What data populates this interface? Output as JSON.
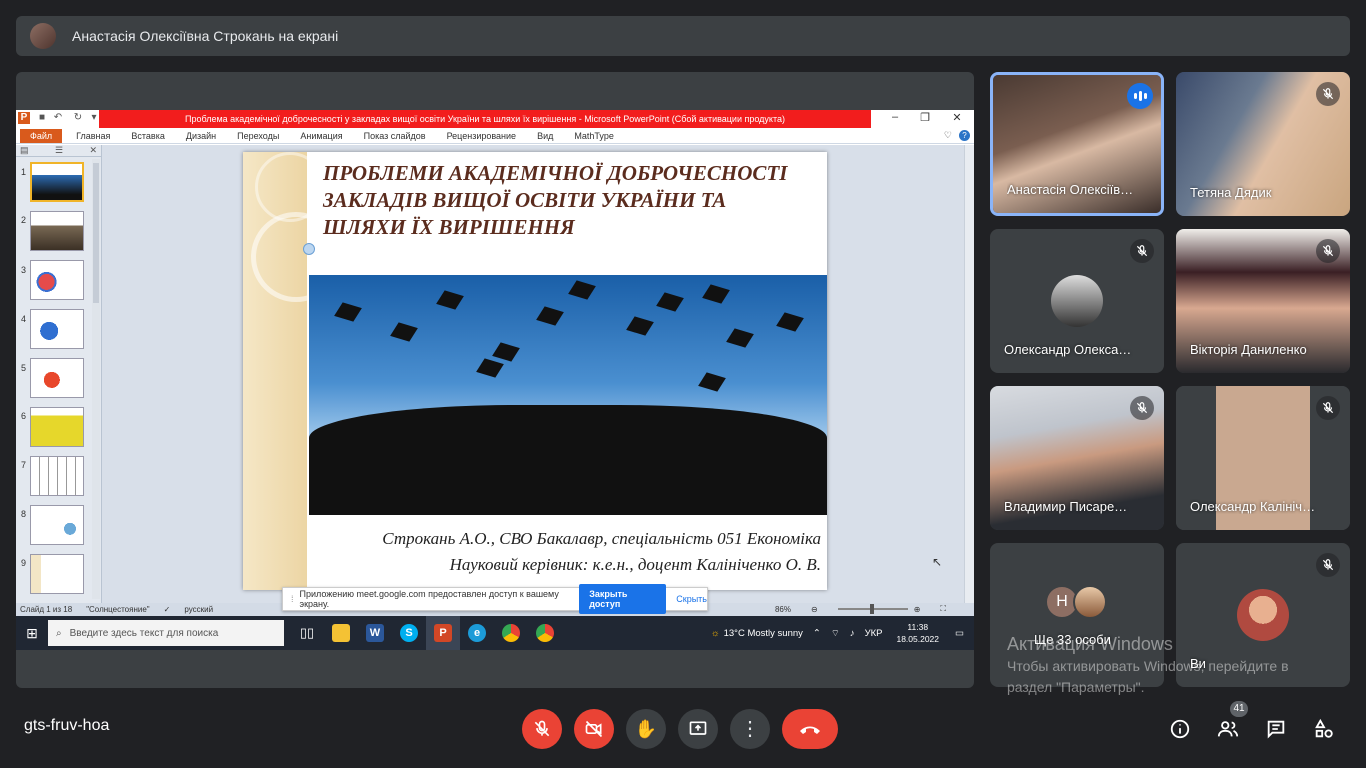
{
  "presenter": {
    "text": "Анастасія Олексіївна Строкань на екрані"
  },
  "ppt": {
    "window_title": "Проблема академічної доброчесності у закладах вищої освіти України та шляхи їх вирішення  -  Microsoft PowerPoint (Сбой активации продукта)",
    "ribbon": {
      "file": "Файл",
      "tabs": [
        "Главная",
        "Вставка",
        "Дизайн",
        "Переходы",
        "Анимация",
        "Показ слайдов",
        "Рецензирование",
        "Вид",
        "MathType"
      ]
    },
    "thumbnails": [
      "1",
      "2",
      "3",
      "4",
      "5",
      "6",
      "7",
      "8",
      "9"
    ],
    "slide": {
      "title": "ПРОБЛЕМИ АКАДЕМІЧНОЇ ДОБРОЧЕСНОСТІ ЗАКЛАДІВ ВИЩОЇ ОСВІТИ УКРАЇНИ ТА ШЛЯХИ ЇХ ВИРІШЕННЯ",
      "authors_line1": "Строкань А.О., СВО Бакалавр, спеціальність 051 Економіка",
      "authors_line2": "Науковий керівник: к.е.н., доцент Калініченко О. В."
    },
    "status": {
      "slide_count": "Слайд 1 из 18",
      "theme": "\"Солнцестояние\"",
      "language": "русский",
      "zoom": "86%"
    }
  },
  "share_toast": {
    "message": "Приложению meet.google.com предоставлен доступ к вашему экрану.",
    "stop_label": "Закрыть доступ",
    "hide_label": "Скрыть"
  },
  "taskbar": {
    "search_placeholder": "Введите здесь текст для поиска",
    "weather": "13°C  Mostly sunny",
    "lang": "УКР",
    "time": "11:38",
    "date": "18.05.2022"
  },
  "participants": [
    {
      "name": "Анастасія Олексіїв…",
      "speaking": true
    },
    {
      "name": "Тетяна Дядик",
      "muted": true
    },
    {
      "name": "Олександр Олекса…",
      "muted": true
    },
    {
      "name": "Вікторія Даниленко",
      "muted": true
    },
    {
      "name": "Владимир Писаре…",
      "muted": true
    },
    {
      "name": "Олександр Калініч…",
      "muted": true
    },
    {
      "name": "Ще 33 особи",
      "initial": "Н"
    },
    {
      "name": "Ви",
      "muted": true
    }
  ],
  "windows_activation": {
    "title": "Активация Windows",
    "line1": "Чтобы активировать Windows, перейдите в",
    "line2": "раздел \"Параметры\"."
  },
  "meeting": {
    "code": "gts-fruv-hoa",
    "participants_count": "41"
  },
  "colors": {
    "accent": "#8ab4f8",
    "danger": "#ea4335",
    "surface": "#3c4043",
    "background": "#202124"
  }
}
